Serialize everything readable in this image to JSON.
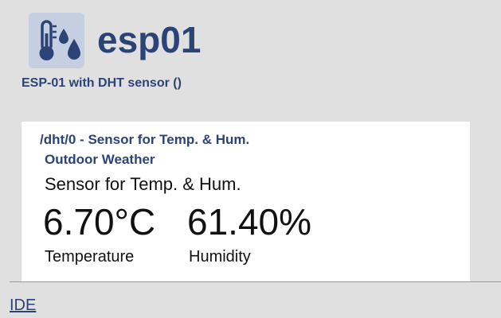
{
  "device": {
    "name": "esp01",
    "subtitle": "ESP-01 with DHT sensor ()",
    "icon": "thermometer-humidity-icon"
  },
  "sensor_card": {
    "header": "/dht/0 - Sensor for Temp. & Hum.",
    "location": "Outdoor Weather",
    "description": "Sensor for Temp. & Hum.",
    "readings": [
      {
        "value": "6.70°C",
        "label": "Temperature"
      },
      {
        "value": "61.40%",
        "label": "Humidity"
      }
    ]
  },
  "footer": {
    "link_label": "IDE"
  },
  "colors": {
    "accent": "#2c4475",
    "icon_background": "#c6cfe2",
    "page_background": "#e0e0e0",
    "card_background": "#ffffff"
  }
}
